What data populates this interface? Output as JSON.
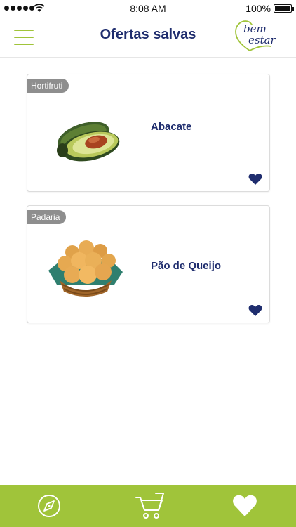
{
  "status_bar": {
    "time": "8:08 AM",
    "battery": "100%"
  },
  "header": {
    "title": "Ofertas salvas",
    "logo_line1": "bem",
    "logo_line2": "estar"
  },
  "offers": [
    {
      "category": "Hortifruti",
      "name": "Abacate",
      "image_icon": "avocado-image",
      "favorited": true
    },
    {
      "category": "Padaria",
      "name": "Pão de Queijo",
      "image_icon": "cheese-bread-basket-image",
      "favorited": true
    }
  ],
  "bottom_nav": {
    "items": [
      {
        "icon": "compass-icon"
      },
      {
        "icon": "cart-icon"
      },
      {
        "icon": "heart-icon"
      }
    ]
  },
  "colors": {
    "brand_green": "#a0c43a",
    "navy": "#1f2d6e",
    "tag_gray": "#8e8e8e"
  }
}
